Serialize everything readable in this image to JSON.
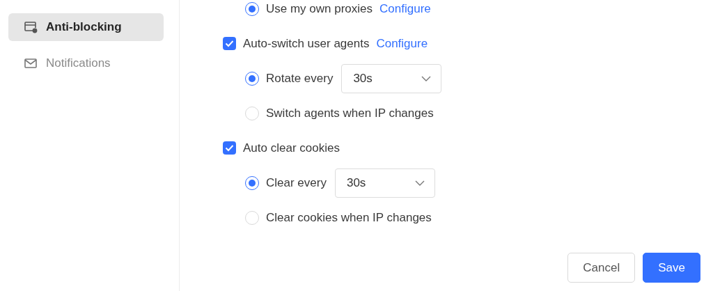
{
  "sidebar": {
    "items": [
      {
        "label": "Anti-blocking",
        "kind": "window",
        "selected": true
      },
      {
        "label": "Notifications",
        "kind": "mail",
        "selected": false
      }
    ]
  },
  "sections": [
    {
      "options": [
        {
          "label": "Use my own proxies",
          "selected": true,
          "link": "Configure"
        }
      ]
    },
    {
      "checkbox": {
        "label": "Auto-switch user agents",
        "checked": true,
        "link": "Configure"
      },
      "options": [
        {
          "label": "Rotate every",
          "selected": true,
          "select": {
            "value": "30s"
          }
        },
        {
          "label": "Switch agents when IP changes",
          "selected": false
        }
      ]
    },
    {
      "checkbox": {
        "label": "Auto clear cookies",
        "checked": true
      },
      "options": [
        {
          "label": "Clear every",
          "selected": true,
          "select": {
            "value": "30s"
          }
        },
        {
          "label": "Clear cookies when IP changes",
          "selected": false
        }
      ]
    }
  ],
  "buttons": [
    {
      "label": "Cancel",
      "kind": "secondary"
    },
    {
      "label": "Save",
      "kind": "primary"
    }
  ]
}
